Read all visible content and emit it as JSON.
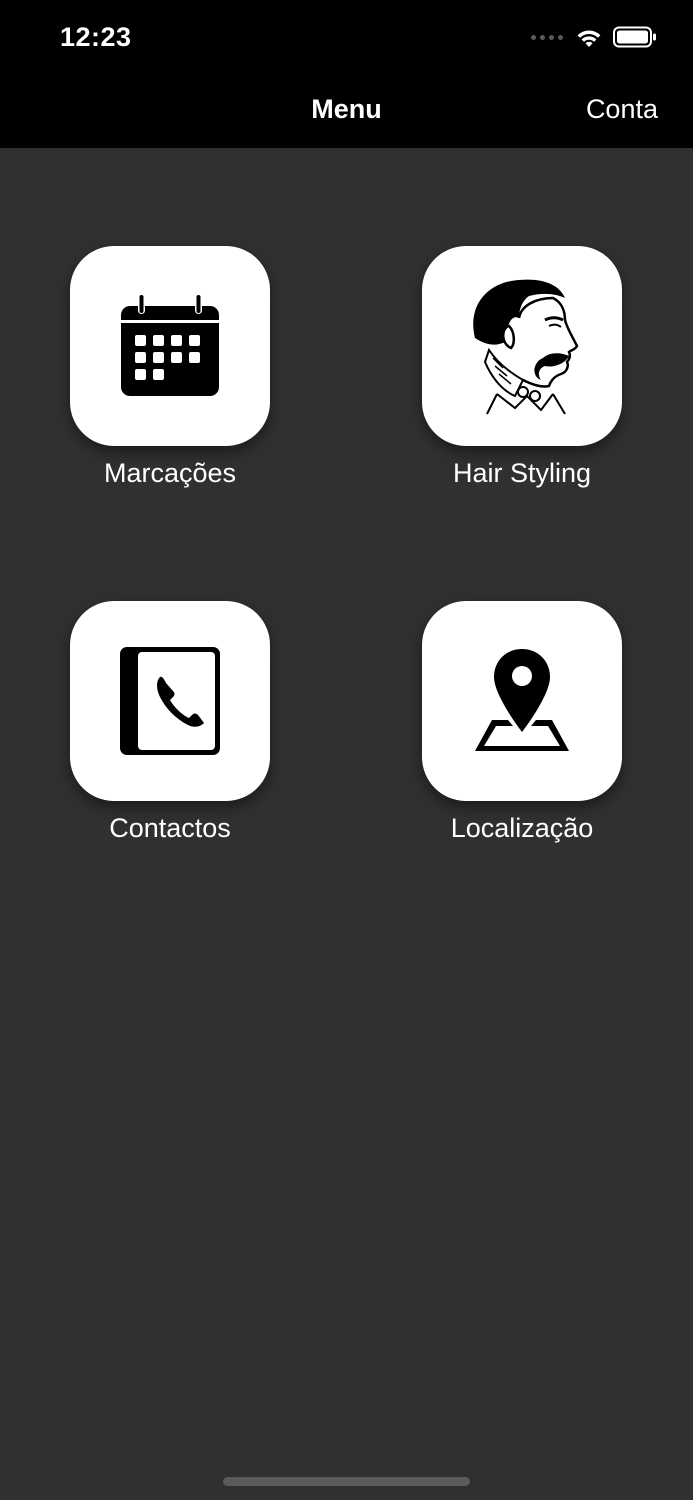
{
  "status_bar": {
    "time": "12:23",
    "icons": [
      "signal-dots-icon",
      "wifi-icon",
      "battery-icon"
    ]
  },
  "nav": {
    "title": "Menu",
    "right_button": "Conta"
  },
  "tiles": [
    {
      "label": "Marcações",
      "icon": "calendar-icon"
    },
    {
      "label": "Hair Styling",
      "icon": "barber-man-portrait-icon"
    },
    {
      "label": "Contactos",
      "icon": "phone-book-icon"
    },
    {
      "label": "Localização",
      "icon": "map-pin-icon"
    }
  ],
  "colors": {
    "background": "#303030",
    "nav_bar": "#000000",
    "tile": "#ffffff",
    "text": "#ffffff"
  }
}
